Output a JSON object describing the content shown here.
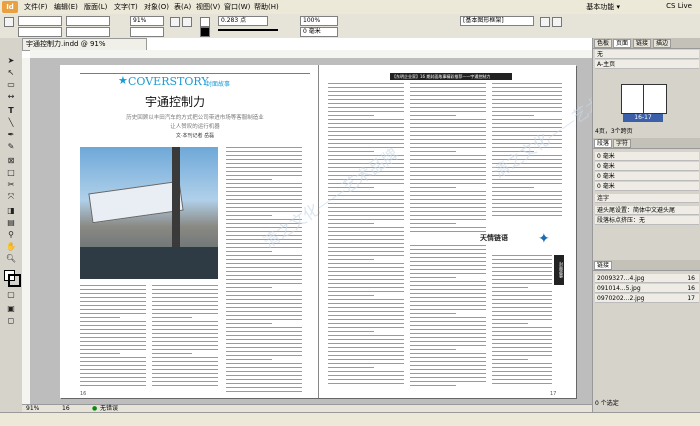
{
  "app": {
    "logo": "Id",
    "workspace": "基本功能 ▾",
    "cslive": "CS Live"
  },
  "menu": [
    "文件(F)",
    "编辑(E)",
    "版面(L)",
    "文字(T)",
    "对象(O)",
    "表(A)",
    "视图(V)",
    "窗口(W)",
    "帮助(H)"
  ],
  "controlbar": {
    "zoom": "91%",
    "stroke": "0.283 点",
    "fill_value": "0 毫米",
    "style": "[基本图形框架]",
    "opacity": "100%"
  },
  "document": {
    "tab": "宇通控制力.indd @ 91%",
    "page_indicator": "16-17",
    "zoom_status": "91%"
  },
  "left_page": {
    "header_logo": "COVERSTORY",
    "header_sub": "封面故事",
    "title": "宇通控制力",
    "subtitle_1": "历史回顾以丰田汽车的方式把公司带进市场等客服制造业",
    "subtitle_2": "让人赞叹的运行机器",
    "byline": "文·本刊记者 岳磊",
    "page_num": "16"
  },
  "right_page": {
    "banner": "【东明企业家】16 期封面故事精彩推荐——宇通控制力",
    "section_title": "天情链语",
    "page_num": "17",
    "side_tab": "封面故事"
  },
  "watermark": "清之文化——艺术品牌",
  "panels": {
    "tabs_top": [
      "色板",
      "页面",
      "链接",
      "描边"
    ],
    "pages_label": "无",
    "master": "A-主页",
    "spread_label": "16-17",
    "pages_status": "4页，3个跨页",
    "tabs_mid": [
      "段落",
      "字符"
    ],
    "para_rows": [
      "0 毫米",
      "0 毫米",
      "0 毫米",
      "0 毫米"
    ],
    "hyphen": "连字",
    "text_wrap": "避头尾设置：简体中文避头尾",
    "justify": "段落标点挤压：无",
    "tabs_links": [
      "链接"
    ],
    "links": [
      {
        "name": "2009327...4.jpg",
        "page": "16"
      },
      {
        "name": "091014...5.jpg",
        "page": "16"
      },
      {
        "name": "0970202...2.jpg",
        "page": "17"
      }
    ],
    "links_status": "0 个选定"
  },
  "status": {
    "page_field": "16",
    "preflight": "无错误"
  }
}
